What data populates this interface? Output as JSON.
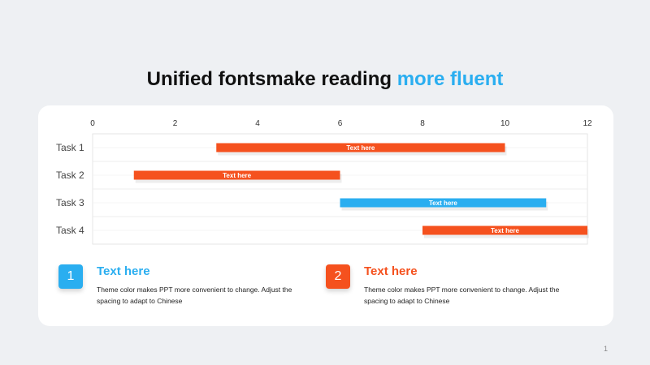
{
  "slide": {
    "title_main": "Unified fontsmake reading",
    "title_accent": "more fluent",
    "page_number": "1",
    "colors": {
      "blue": "#2aaef0",
      "red": "#f5511e",
      "background": "#eef0f3"
    }
  },
  "chart_data": {
    "type": "bar",
    "orientation": "horizontal-gantt",
    "xlim": [
      0,
      12
    ],
    "x_ticks": [
      "0",
      "2",
      "4",
      "6",
      "8",
      "10",
      "12"
    ],
    "grid": true,
    "tasks": [
      {
        "label": "Task 1",
        "start": 3,
        "end": 10,
        "text": "Text here",
        "color": "#f5511e"
      },
      {
        "label": "Task 2",
        "start": 1,
        "end": 6,
        "text": "Text here",
        "color": "#f5511e"
      },
      {
        "label": "Task 3",
        "start": 6,
        "end": 11,
        "text": "Text here",
        "color": "#2aaef0"
      },
      {
        "label": "Task 4",
        "start": 8,
        "end": 12,
        "text": "Text here",
        "color": "#f5511e"
      }
    ]
  },
  "info": [
    {
      "number": "1",
      "heading": "Text here",
      "body": "Theme  color makes PPT more convenient  to change. Adjust the spacing to adapt to Chinese"
    },
    {
      "number": "2",
      "heading": "Text here",
      "body": "Theme  color makes PPT more convenient  to change. Adjust the spacing to adapt to Chinese"
    }
  ]
}
